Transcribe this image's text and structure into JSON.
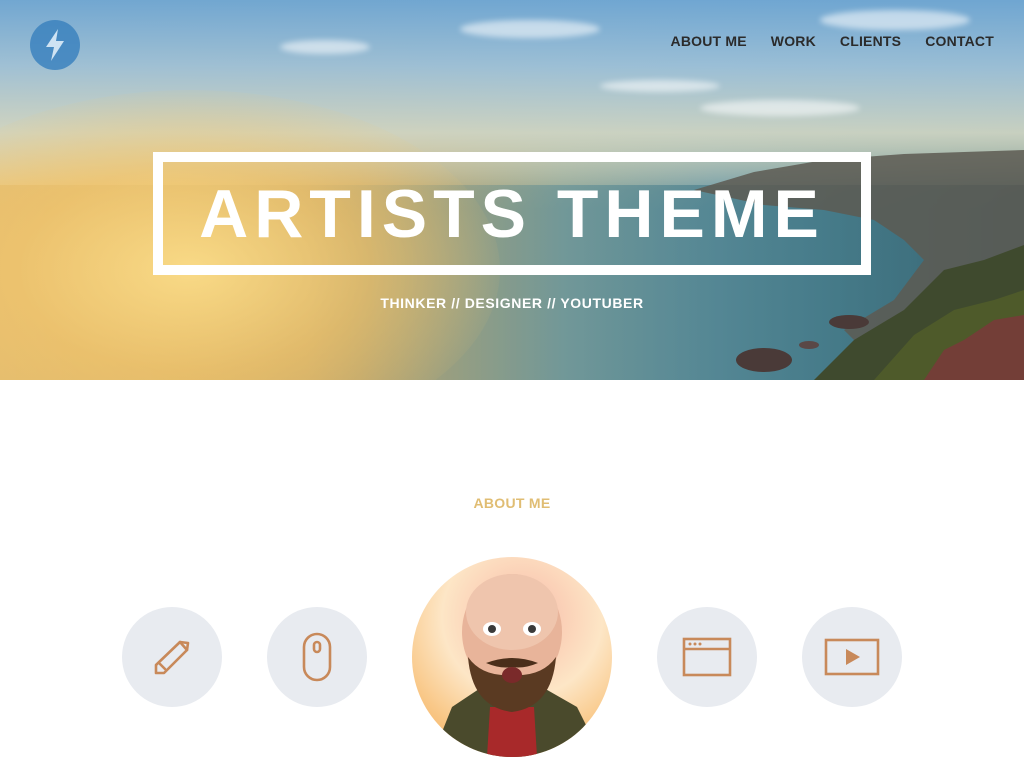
{
  "header": {
    "logo_icon": "lightning-bolt-icon",
    "nav": [
      {
        "label": "ABOUT ME"
      },
      {
        "label": "WORK"
      },
      {
        "label": "CLIENTS"
      },
      {
        "label": "CONTACT"
      }
    ]
  },
  "hero": {
    "title": "ARTISTS THEME",
    "subtitle": "THINKER // DESIGNER // YOUTUBER"
  },
  "about": {
    "heading": "ABOUT ME",
    "icons": [
      "pencil-icon",
      "mouse-icon",
      "browser-window-icon",
      "play-video-icon"
    ],
    "accent_color": "#e0bd73",
    "icon_color": "#c8895a"
  }
}
